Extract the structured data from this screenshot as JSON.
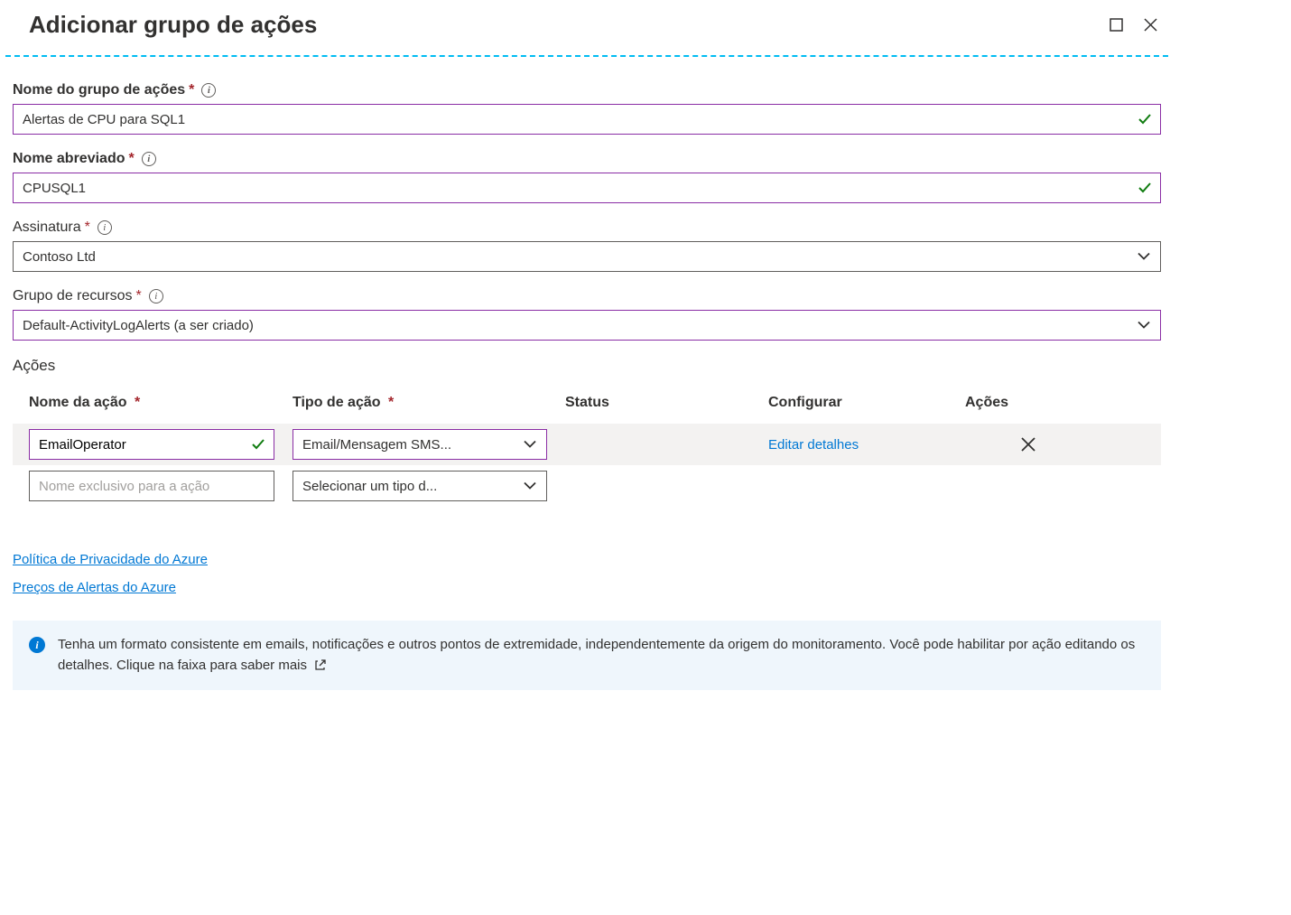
{
  "header": {
    "title": "Adicionar grupo de ações"
  },
  "form": {
    "group_name": {
      "label": "Nome do grupo de ações",
      "value": "Alertas de CPU para SQL1"
    },
    "short_name": {
      "label": "Nome abreviado",
      "value": "CPUSQL1"
    },
    "subscription": {
      "label": "Assinatura",
      "value": "Contoso Ltd"
    },
    "resource_group": {
      "label": "Grupo de recursos",
      "value": "Default-ActivityLogAlerts (a ser criado)"
    }
  },
  "actions": {
    "heading": "Ações",
    "columns": {
      "name": "Nome da ação",
      "type": "Tipo de ação",
      "status": "Status",
      "configure": "Configurar",
      "actions": "Ações"
    },
    "rows": [
      {
        "name": "EmailOperator",
        "type": "Email/Mensagem SMS...",
        "configure": "Editar detalhes"
      }
    ],
    "placeholder_row": {
      "name_placeholder": "Nome exclusivo para a ação",
      "type_placeholder": "Selecionar um tipo d..."
    }
  },
  "links": {
    "privacy": "Política de Privacidade do Azure",
    "pricing": "Preços de Alertas do Azure"
  },
  "info_box": {
    "text": "Tenha um formato consistente em emails, notificações e outros pontos de extremidade, independentemente da origem do monitoramento. Você pode habilitar por ação editando os detalhes. Clique na faixa para saber mais"
  }
}
